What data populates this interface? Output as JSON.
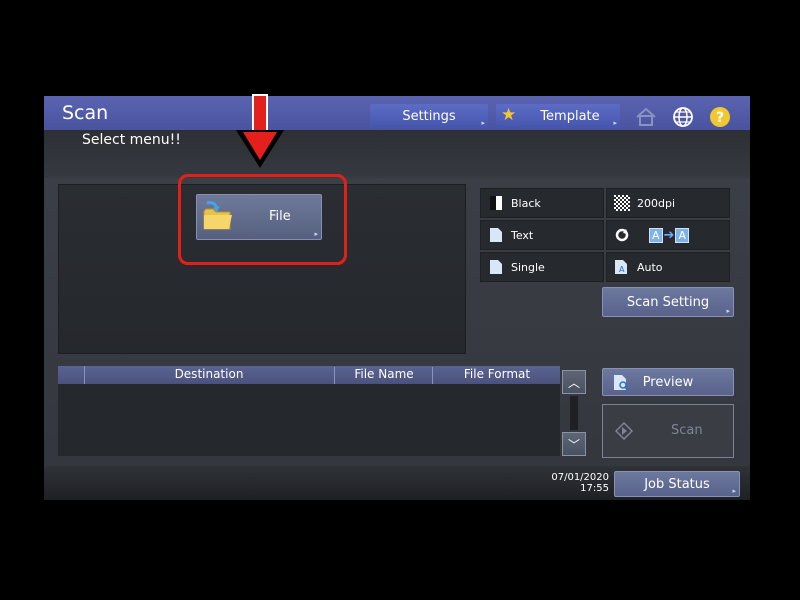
{
  "titlebar": {
    "title": "Scan",
    "settings_label": "Settings",
    "template_label": "Template",
    "icons": [
      "home-icon",
      "globe-icon",
      "help-icon"
    ],
    "accent_color": "#4a53a0"
  },
  "subtitle": "Select menu!!",
  "main": {
    "file_button_label": "File",
    "highlight_color": "#e0201b"
  },
  "settings": {
    "tiles": [
      {
        "icon": "color-mode-icon",
        "label": "Black"
      },
      {
        "icon": "resolution-icon",
        "label": "200dpi"
      },
      {
        "icon": "original-mode-icon",
        "label": "Text"
      },
      {
        "icon": "rotation-icon",
        "label": ""
      },
      {
        "icon": "single-sided-icon",
        "label": "Single"
      },
      {
        "icon": "original-size-icon",
        "label": "Auto"
      }
    ],
    "scan_setting_label": "Scan Setting"
  },
  "table": {
    "columns": [
      "Destination",
      "File Name",
      "File Format"
    ]
  },
  "actions": {
    "preview_label": "Preview",
    "scan_label": "Scan"
  },
  "status": {
    "date": "07/01/2020",
    "time": "17:55",
    "job_status_label": "Job Status"
  }
}
